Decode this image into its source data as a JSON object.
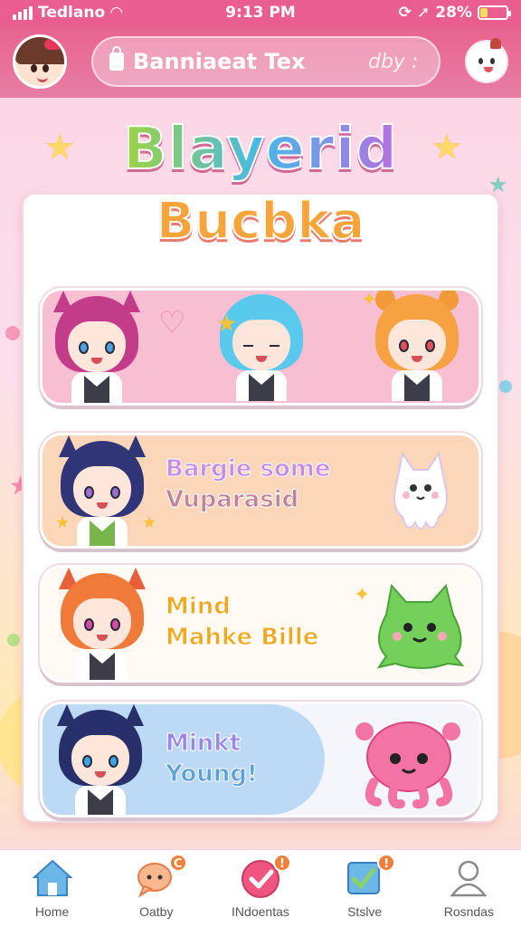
{
  "status_bar": {
    "carrier": "Tedlano",
    "time": "9:13 PM",
    "battery": "28%",
    "battery_level": 0.28
  },
  "header": {
    "search_placeholder": "Banniaeat Tex",
    "search_hint": "dby :",
    "avatar_icon": "girl-avatar-icon",
    "mascot_icon": "mascot-face-icon"
  },
  "titles": {
    "main": "Blayerid",
    "sub": "Bucbka"
  },
  "cards": [
    {
      "line1": "",
      "line2": ""
    },
    {
      "line1": "Bargie some",
      "line2": "Vuparasid"
    },
    {
      "line1": "Mind",
      "line2": "Mahke Bille"
    },
    {
      "line1": "Minkt",
      "line2": "Young!"
    }
  ],
  "bottom_nav": [
    {
      "label": "Home",
      "icon": "home-icon",
      "badge": ""
    },
    {
      "label": "Oatby",
      "icon": "chat-bubble-icon",
      "badge": "C"
    },
    {
      "label": "INdoentas",
      "icon": "heart-check-icon",
      "badge": "!"
    },
    {
      "label": "Stslve",
      "icon": "edit-check-icon",
      "badge": "!"
    },
    {
      "label": "Rosndas",
      "icon": "profile-icon",
      "badge": ""
    }
  ],
  "colors": {
    "header": "#e8628f",
    "accent_pink": "#f8bfd3",
    "accent_peach": "#fbd6b9",
    "accent_blue": "#bcd9f5"
  }
}
